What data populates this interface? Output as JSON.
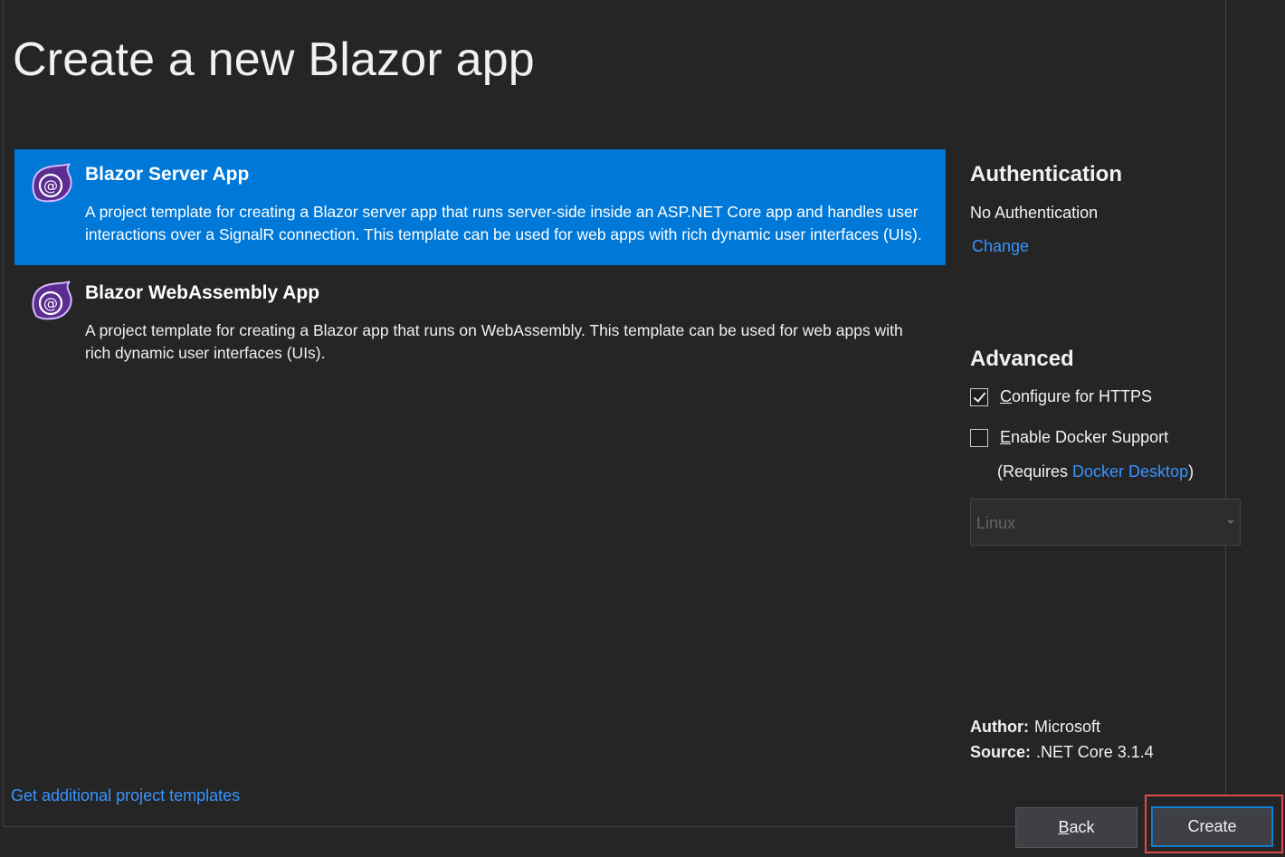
{
  "page": {
    "title": "Create a new Blazor app"
  },
  "templates": [
    {
      "name": "Blazor Server App",
      "description_line1": "A project template for creating a Blazor server app that runs server-side inside an ASP.NET Core app and handles user",
      "description_line2": "interactions over a SignalR connection. This template can be used for web apps with rich dynamic user interfaces (UIs).",
      "selected": true,
      "icon": "blazor-icon"
    },
    {
      "name": "Blazor WebAssembly App",
      "description_line1": "A project template for creating a Blazor app that runs on WebAssembly. This template can be used for web apps with",
      "description_line2": "rich dynamic user interfaces (UIs).",
      "selected": false,
      "icon": "blazor-icon"
    }
  ],
  "authentication": {
    "title": "Authentication",
    "value": "No Authentication",
    "change_label": "Change"
  },
  "advanced": {
    "title": "Advanced",
    "https": {
      "accel": "C",
      "label_rest": "onfigure for HTTPS",
      "checked": true
    },
    "docker": {
      "accel": "E",
      "label_rest": "nable Docker Support",
      "checked": false
    },
    "requires_prefix": "(Requires ",
    "requires_link": "Docker Desktop",
    "requires_suffix": ")",
    "os_selected": "Linux"
  },
  "meta": {
    "author_label": "Author:",
    "author_value": "Microsoft",
    "source_label": "Source:",
    "source_value": ".NET Core 3.1.4"
  },
  "footer": {
    "more_templates": "Get additional project templates",
    "back_accel": "B",
    "back_rest": "ack",
    "create_label": "Create"
  },
  "colors": {
    "background": "#252526",
    "selection": "#0078d7",
    "link": "#3794ff",
    "highlight": "#e04a4a"
  }
}
